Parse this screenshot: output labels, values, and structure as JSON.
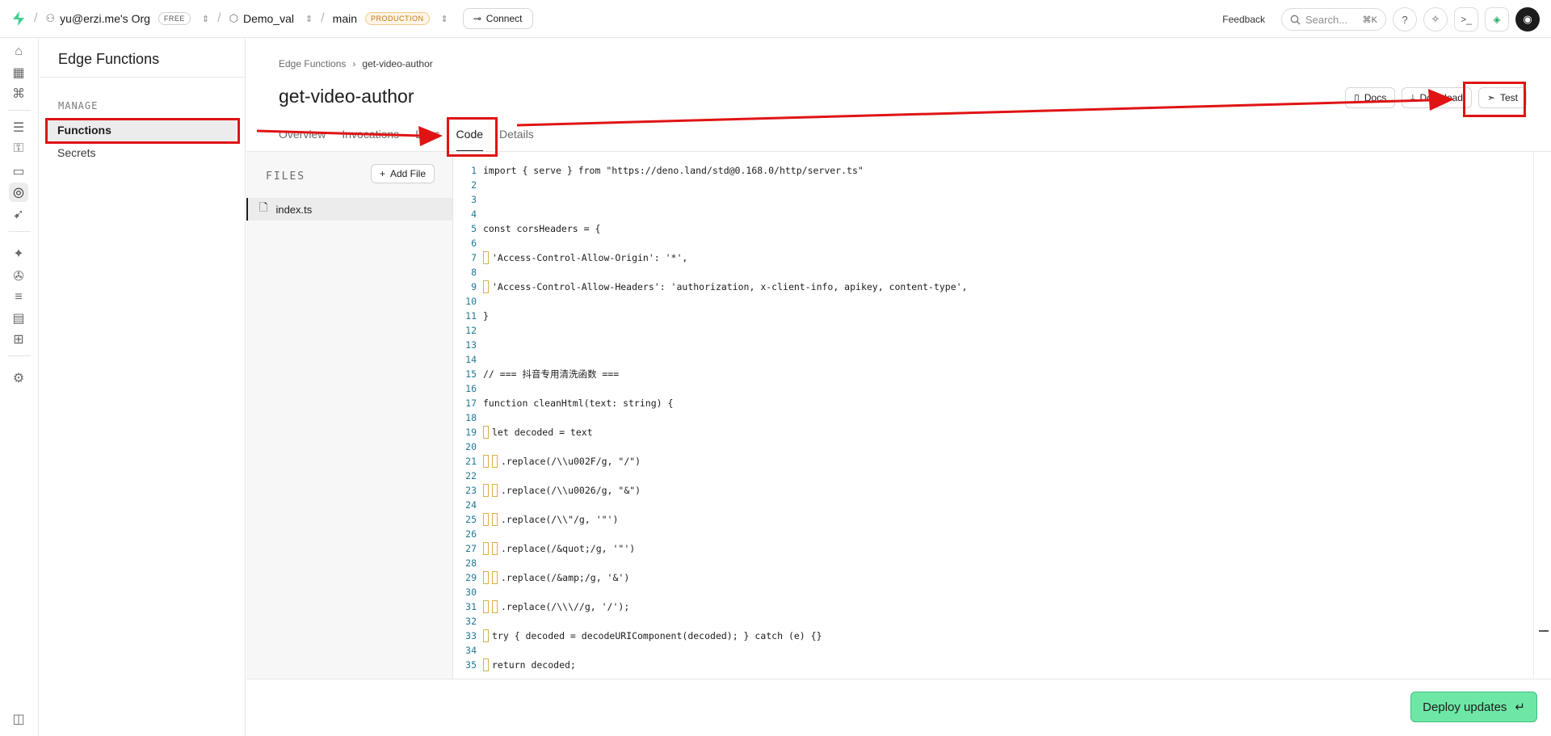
{
  "topbar": {
    "org": "yu@erzi.me's Org",
    "org_badge": "FREE",
    "project": "Demo_val",
    "branch": "main",
    "branch_badge": "PRODUCTION",
    "connect": "Connect",
    "feedback": "Feedback",
    "search_placeholder": "Search...",
    "search_shortcut": "⌘K"
  },
  "sidebar": {
    "title": "Edge Functions",
    "section": "MANAGE",
    "items": [
      {
        "label": "Functions"
      },
      {
        "label": "Secrets"
      }
    ]
  },
  "page": {
    "breadcrumb_root": "Edge Functions",
    "breadcrumb_current": "get-video-author",
    "title": "get-video-author",
    "buttons": {
      "docs": "Docs",
      "download": "Download",
      "test": "Test"
    },
    "tabs": [
      {
        "label": "Overview"
      },
      {
        "label": "Invocations"
      },
      {
        "label": "Logs"
      },
      {
        "label": "Code"
      },
      {
        "label": "Details"
      }
    ]
  },
  "files": {
    "label": "FILES",
    "add_file": "Add File",
    "items": [
      {
        "name": "index.ts"
      }
    ]
  },
  "code": {
    "lines": [
      {
        "n": "1",
        "text": "import { serve } from \"https://deno.land/std@0.168.0/http/server.ts\"",
        "guides": 0
      },
      {
        "n": "2",
        "text": "",
        "guides": 0
      },
      {
        "n": "3",
        "text": "",
        "guides": 0
      },
      {
        "n": "4",
        "text": "",
        "guides": 0
      },
      {
        "n": "5",
        "text": "const corsHeaders = {",
        "guides": 0
      },
      {
        "n": "6",
        "text": "",
        "guides": 0
      },
      {
        "n": "7",
        "text": "'Access-Control-Allow-Origin': '*',",
        "guides": 1
      },
      {
        "n": "8",
        "text": "",
        "guides": 0
      },
      {
        "n": "9",
        "text": "'Access-Control-Allow-Headers': 'authorization, x-client-info, apikey, content-type',",
        "guides": 1
      },
      {
        "n": "10",
        "text": "",
        "guides": 0
      },
      {
        "n": "11",
        "text": "}",
        "guides": 0
      },
      {
        "n": "12",
        "text": "",
        "guides": 0
      },
      {
        "n": "13",
        "text": "",
        "guides": 0
      },
      {
        "n": "14",
        "text": "",
        "guides": 0
      },
      {
        "n": "15",
        "text": "// === 抖音专用清洗函数 ===",
        "guides": 0
      },
      {
        "n": "16",
        "text": "",
        "guides": 0
      },
      {
        "n": "17",
        "text": "function cleanHtml(text: string) {",
        "guides": 0
      },
      {
        "n": "18",
        "text": "",
        "guides": 0
      },
      {
        "n": "19",
        "text": "let decoded = text",
        "guides": 1
      },
      {
        "n": "20",
        "text": "",
        "guides": 0
      },
      {
        "n": "21",
        "text": ".replace(/\\\\u002F/g, \"/\")",
        "guides": 2
      },
      {
        "n": "22",
        "text": "",
        "guides": 0
      },
      {
        "n": "23",
        "text": ".replace(/\\\\u0026/g, \"&\")",
        "guides": 2
      },
      {
        "n": "24",
        "text": "",
        "guides": 0
      },
      {
        "n": "25",
        "text": ".replace(/\\\\\"/g, '\"')",
        "guides": 2
      },
      {
        "n": "26",
        "text": "",
        "guides": 0
      },
      {
        "n": "27",
        "text": ".replace(/&quot;/g, '\"')",
        "guides": 2
      },
      {
        "n": "28",
        "text": "",
        "guides": 0
      },
      {
        "n": "29",
        "text": ".replace(/&amp;/g, '&')",
        "guides": 2
      },
      {
        "n": "30",
        "text": "",
        "guides": 0
      },
      {
        "n": "31",
        "text": ".replace(/\\\\\\//g, '/');",
        "guides": 2
      },
      {
        "n": "32",
        "text": "",
        "guides": 0
      },
      {
        "n": "33",
        "text": "try { decoded = decodeURIComponent(decoded); } catch (e) {}",
        "guides": 1
      },
      {
        "n": "34",
        "text": "",
        "guides": 0
      },
      {
        "n": "35",
        "text": "return decoded;",
        "guides": 1
      }
    ]
  },
  "footer": {
    "deploy": "Deploy updates"
  },
  "colors": {
    "accent": "#6ee7a6",
    "annotation": "#e01414"
  }
}
